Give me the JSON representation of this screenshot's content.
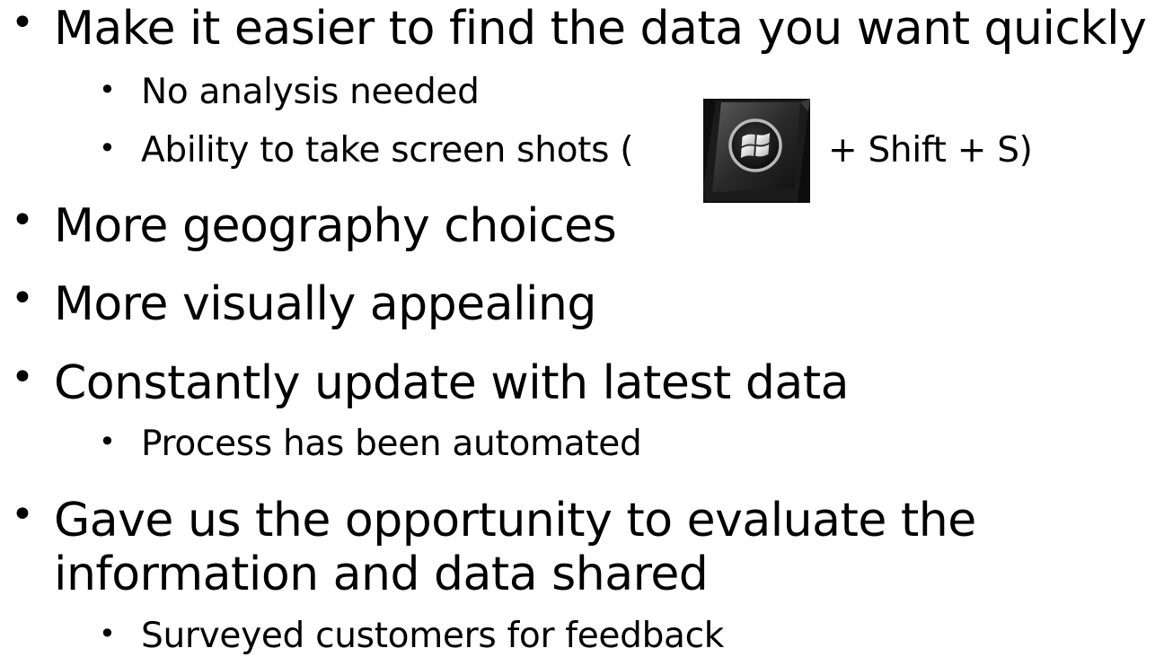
{
  "slide": {
    "bullets": [
      {
        "text": "Make it easier to find the data you want quickly",
        "sub": [
          {
            "text": "No analysis needed"
          },
          {
            "text_before_icon": "Ability to take screen shots (",
            "icon": "windows-key-icon",
            "text_after_icon": "+ Shift + S)"
          }
        ]
      },
      {
        "text": "More geography choices"
      },
      {
        "text": "More visually appealing"
      },
      {
        "text": "Constantly update with latest data",
        "sub": [
          {
            "text": "Process has been automated"
          }
        ]
      },
      {
        "text_line1": "Gave us the opportunity to evaluate the",
        "text_line2": "information and data shared",
        "sub": [
          {
            "text": "Surveyed customers for feedback"
          }
        ]
      }
    ],
    "bullet_glyph": "•",
    "colors": {
      "text": "#000000",
      "background": "#ffffff"
    }
  }
}
